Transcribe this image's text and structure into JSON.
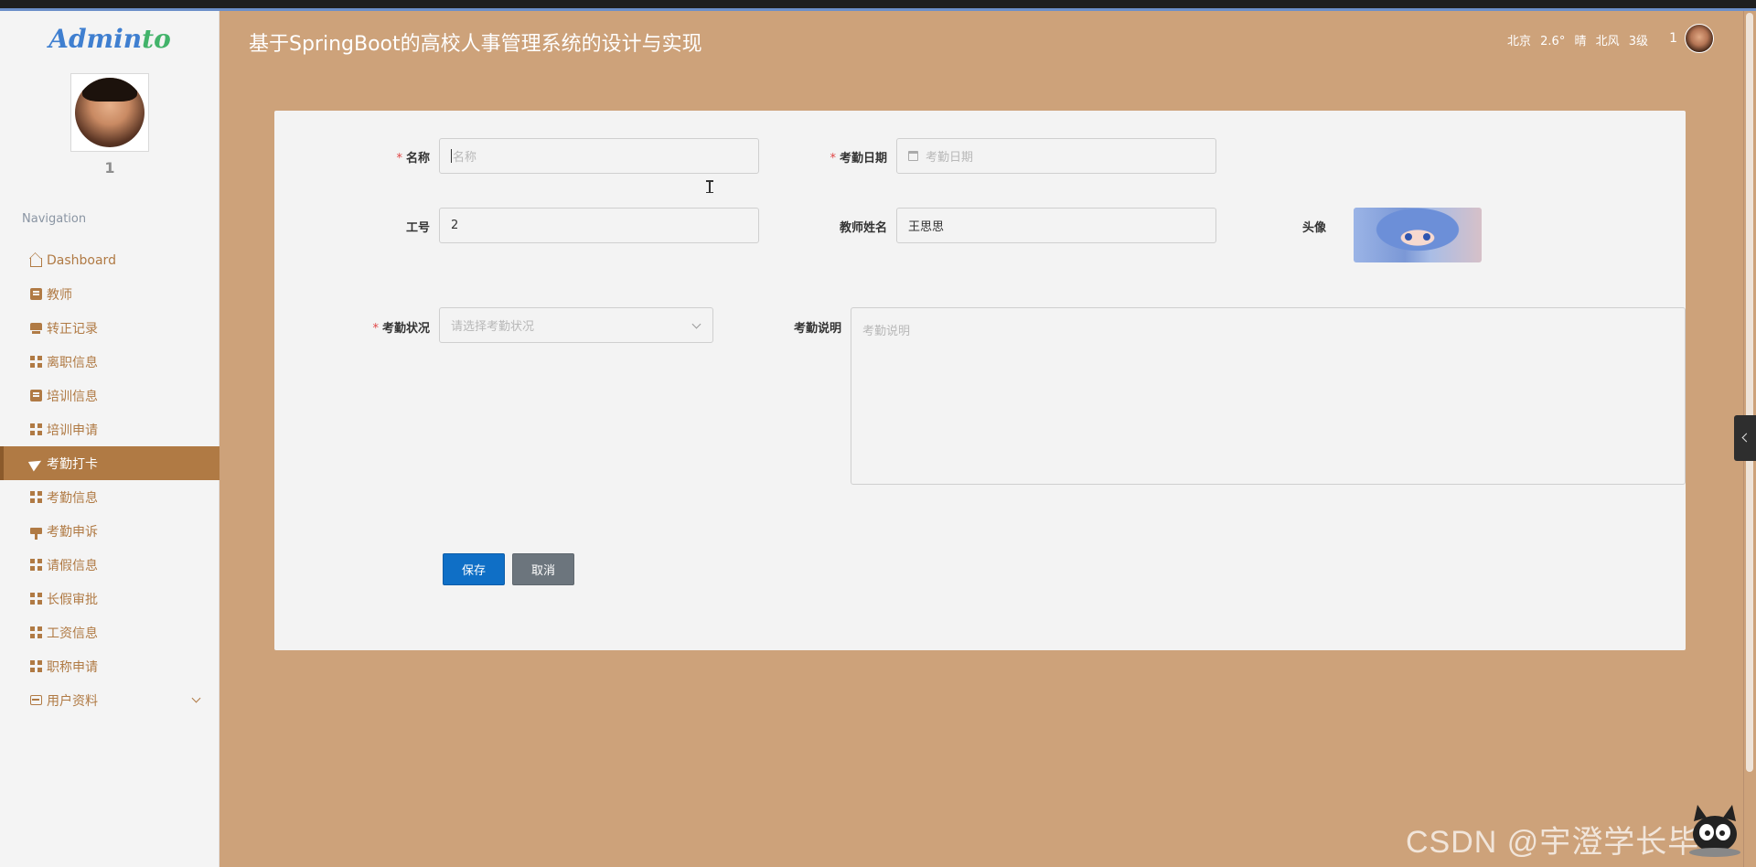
{
  "app": {
    "logo_part1": "Admin",
    "logo_part2": "to",
    "title": "基于SpringBoot的高校人事管理系统的设计与实现"
  },
  "header": {
    "weather": "北京 2.6° 晴 北风 3级",
    "user_name": "1"
  },
  "sidebar": {
    "user_name": "1",
    "nav_title": "Navigation",
    "items": [
      {
        "label": "Dashboard",
        "icon": "home-icon"
      },
      {
        "label": "教师",
        "icon": "clipboard-icon"
      },
      {
        "label": "转正记录",
        "icon": "card-icon"
      },
      {
        "label": "离职信息",
        "icon": "grid-icon"
      },
      {
        "label": "培训信息",
        "icon": "clipboard-icon"
      },
      {
        "label": "培训申请",
        "icon": "grid-icon"
      },
      {
        "label": "考勤打卡",
        "icon": "paper-plane-icon",
        "active": true
      },
      {
        "label": "考勤信息",
        "icon": "grid-icon"
      },
      {
        "label": "考勤申诉",
        "icon": "pin-icon"
      },
      {
        "label": "请假信息",
        "icon": "grid-icon"
      },
      {
        "label": "长假审批",
        "icon": "grid-icon"
      },
      {
        "label": "工资信息",
        "icon": "grid9-icon"
      },
      {
        "label": "职称申请",
        "icon": "grid-icon"
      },
      {
        "label": "用户资料",
        "icon": "wallet-icon",
        "expandable": true
      }
    ]
  },
  "form": {
    "name_label": "名称",
    "name_placeholder": "名称",
    "date_label": "考勤日期",
    "date_placeholder": "考勤日期",
    "job_no_label": "工号",
    "job_no_value": "2",
    "teacher_label": "教师姓名",
    "teacher_value": "王思思",
    "avatar_label": "头像",
    "status_label": "考勤状况",
    "status_placeholder": "请选择考勤状况",
    "desc_label": "考勤说明",
    "desc_placeholder": "考勤说明",
    "save_label": "保存",
    "cancel_label": "取消"
  },
  "colors": {
    "accent": "#b07a44",
    "background": "#cda27a",
    "save": "#0f6fc6",
    "cancel": "#6c757d",
    "required": "#e04545"
  },
  "watermark": "CSDN @宇澄学长毕设"
}
